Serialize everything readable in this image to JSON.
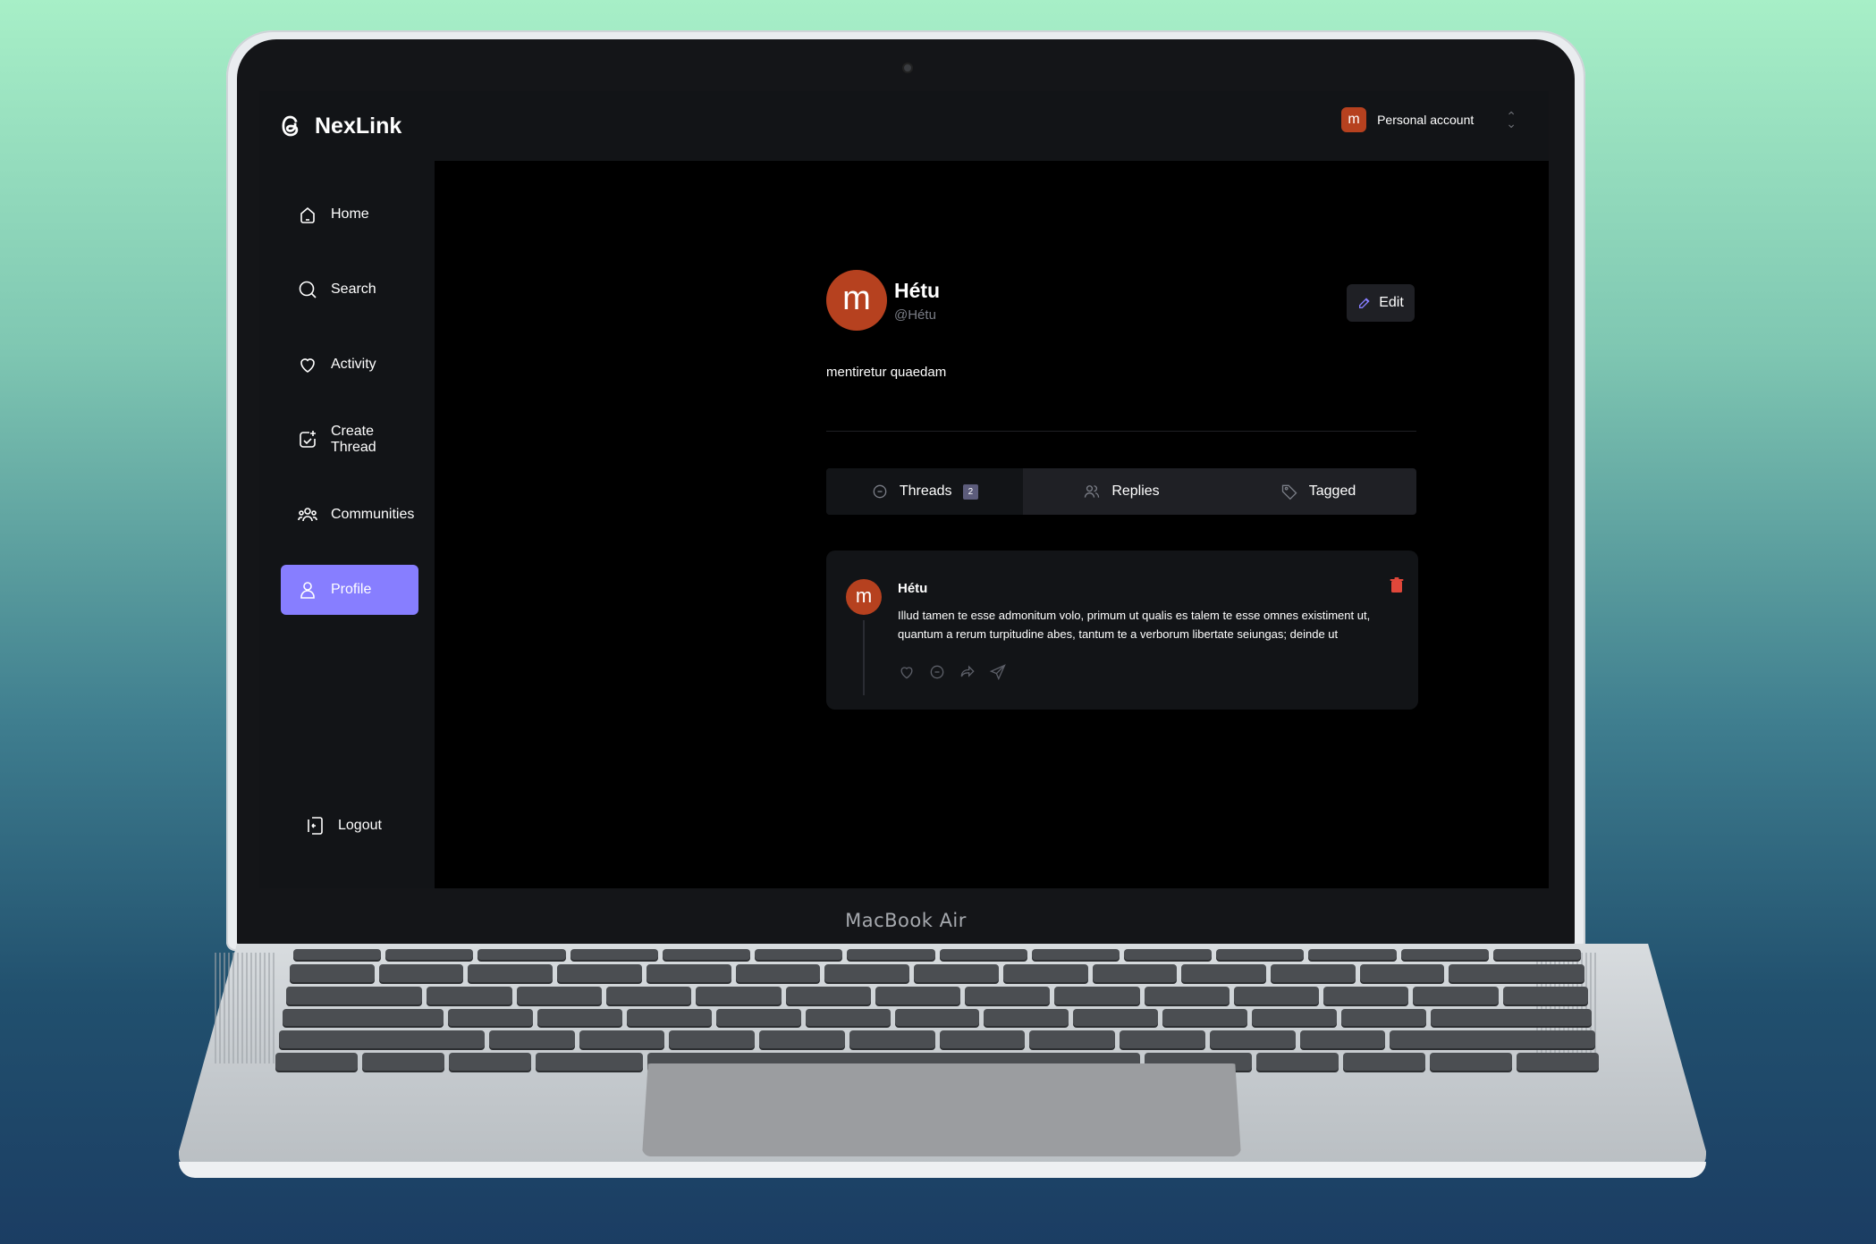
{
  "device": {
    "label": "MacBook Air"
  },
  "app": {
    "name": "NexLink"
  },
  "account": {
    "avatar_letter": "m",
    "label": "Personal account"
  },
  "sidebar": {
    "items": [
      {
        "label": "Home",
        "icon": "home-icon"
      },
      {
        "label": "Search",
        "icon": "search-icon"
      },
      {
        "label": "Activity",
        "icon": "heart-icon"
      },
      {
        "label": "Create Thread",
        "icon": "create-thread-icon"
      },
      {
        "label": "Communities",
        "icon": "communities-icon"
      },
      {
        "label": "Profile",
        "icon": "profile-icon",
        "active": true
      }
    ],
    "logout": {
      "label": "Logout",
      "icon": "logout-icon"
    }
  },
  "profile": {
    "avatar_letter": "m",
    "name": "Hétu",
    "handle": "@Hétu",
    "bio": "mentiretur quaedam",
    "edit_label": "Edit"
  },
  "tabs": [
    {
      "label": "Threads",
      "count": "2",
      "icon": "chat-bubble-icon",
      "active": true
    },
    {
      "label": "Replies",
      "icon": "members-icon"
    },
    {
      "label": "Tagged",
      "icon": "tag-icon"
    }
  ],
  "threads": [
    {
      "avatar_letter": "m",
      "author": "Hétu",
      "text": "Illud tamen te esse admonitum volo, primum ut qualis es talem te esse omnes existiment ut, quantum a rerum turpitudine abes, tantum te a verborum libertate seiungas; deinde ut",
      "actions": [
        "heart-icon",
        "reply-icon",
        "repost-icon",
        "share-icon"
      ]
    }
  ],
  "colors": {
    "accent": "#877eff",
    "avatar": "#b6411f",
    "delete": "#e0473a"
  }
}
